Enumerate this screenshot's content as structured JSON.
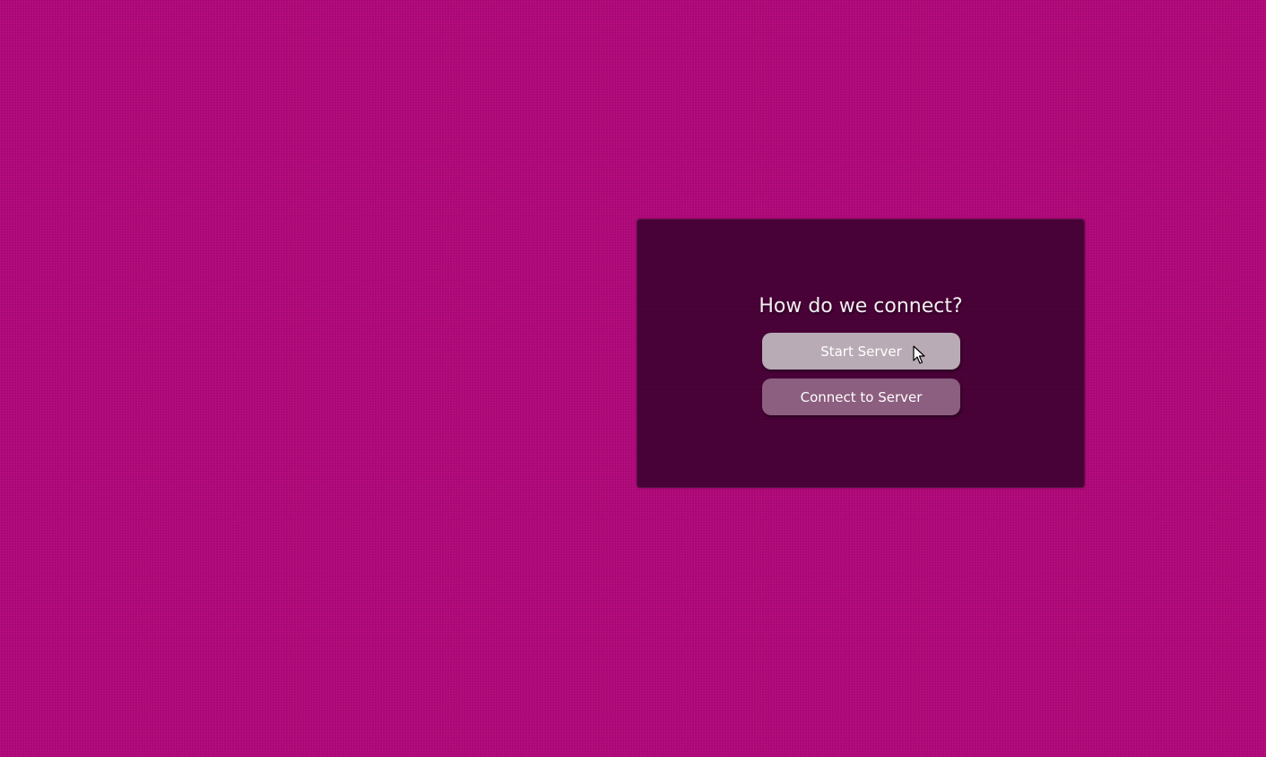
{
  "dialog": {
    "prompt": "How do we connect?",
    "start_server_label": "Start Server",
    "connect_to_server_label": "Connect to Server"
  },
  "colors": {
    "background": "#b1087a",
    "dialog_background": "#4a0238",
    "start_button": "#b9abb5",
    "connect_button": "#8c5e7f",
    "text": "#ffffff"
  },
  "icons": {
    "cursor": "mouse-pointer-icon"
  }
}
